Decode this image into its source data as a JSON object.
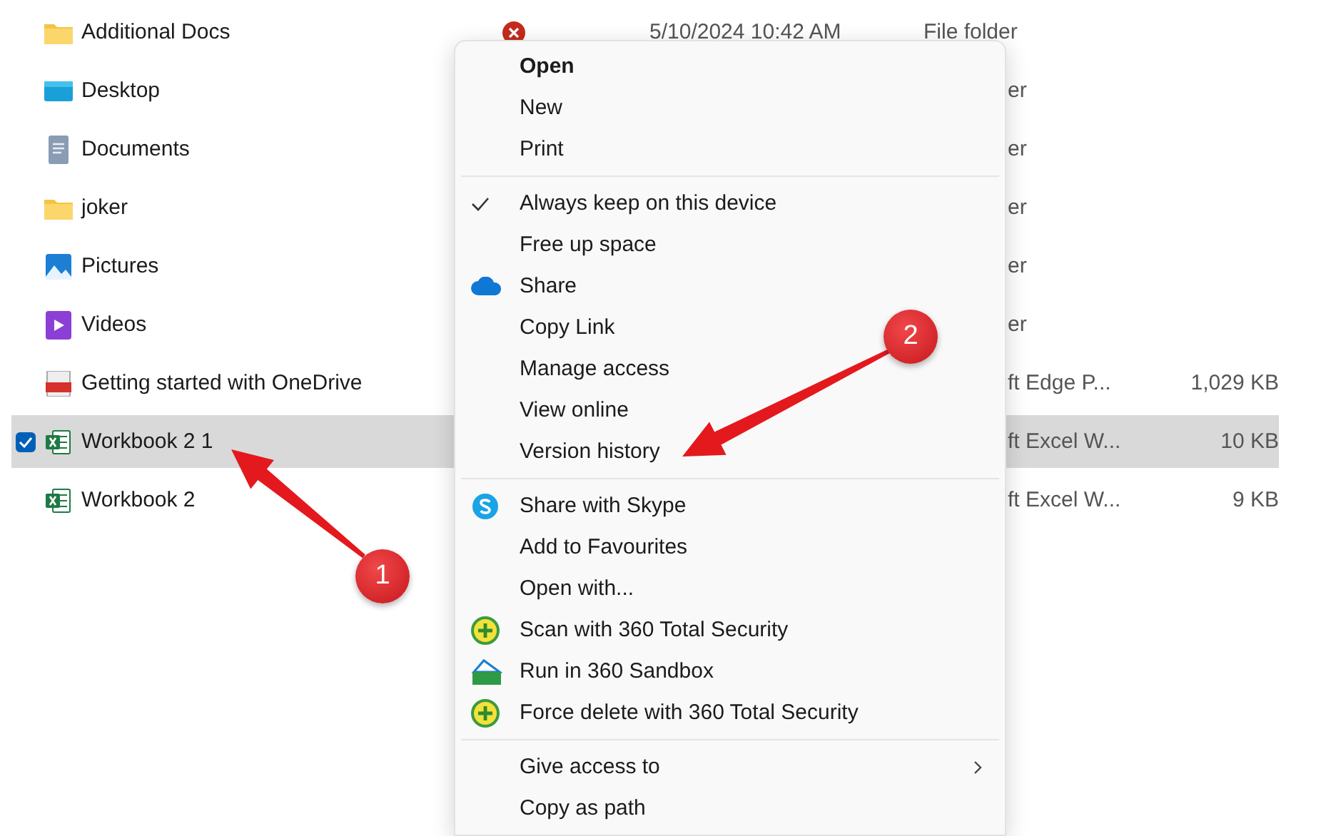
{
  "rows": [
    {
      "name": "Additional Docs",
      "kind": "folder",
      "sync_error": true,
      "date": "5/10/2024 10:42 AM",
      "type": "File folder",
      "selected": false
    },
    {
      "name": "Desktop",
      "kind": "desktop",
      "type": "er",
      "selected": false
    },
    {
      "name": "Documents",
      "kind": "documents",
      "type": "er",
      "selected": false
    },
    {
      "name": "joker",
      "kind": "folder",
      "type": "er",
      "selected": false
    },
    {
      "name": "Pictures",
      "kind": "pictures",
      "type": "er",
      "selected": false
    },
    {
      "name": "Videos",
      "kind": "videos",
      "type": "er",
      "selected": false
    },
    {
      "name": "Getting started with OneDrive",
      "kind": "pdf",
      "type": "ft Edge P...",
      "size": "1,029 KB",
      "selected": false
    },
    {
      "name": "Workbook 2 1",
      "kind": "excel",
      "type": "ft Excel W...",
      "size": "10 KB",
      "selected": true
    },
    {
      "name": "Workbook 2",
      "kind": "excel",
      "type": "ft Excel W...",
      "size": "9 KB",
      "selected": false
    }
  ],
  "menu": {
    "sections": [
      {
        "items": [
          {
            "label": "Open",
            "default": true
          },
          {
            "label": "New"
          },
          {
            "label": "Print"
          }
        ]
      },
      {
        "items": [
          {
            "label": "Always keep on this device",
            "checked": true
          },
          {
            "label": "Free up space"
          },
          {
            "label": "Share",
            "kind": "onedrive"
          },
          {
            "label": "Copy Link"
          },
          {
            "label": "Manage access"
          },
          {
            "label": "View online"
          },
          {
            "label": "Version history"
          }
        ]
      },
      {
        "items": [
          {
            "label": "Share with Skype",
            "kind": "skype"
          },
          {
            "label": "Add to Favourites"
          },
          {
            "label": "Open with..."
          },
          {
            "label": "Scan with 360 Total Security",
            "kind": "security"
          },
          {
            "label": "Run in 360 Sandbox",
            "kind": "sandbox"
          },
          {
            "label": "Force delete with 360 Total Security",
            "kind": "security"
          }
        ]
      },
      {
        "items": [
          {
            "label": "Give access to",
            "submenu": true
          },
          {
            "label": "Copy as path"
          }
        ]
      }
    ]
  },
  "annotations": [
    {
      "label": "1"
    },
    {
      "label": "2"
    }
  ]
}
